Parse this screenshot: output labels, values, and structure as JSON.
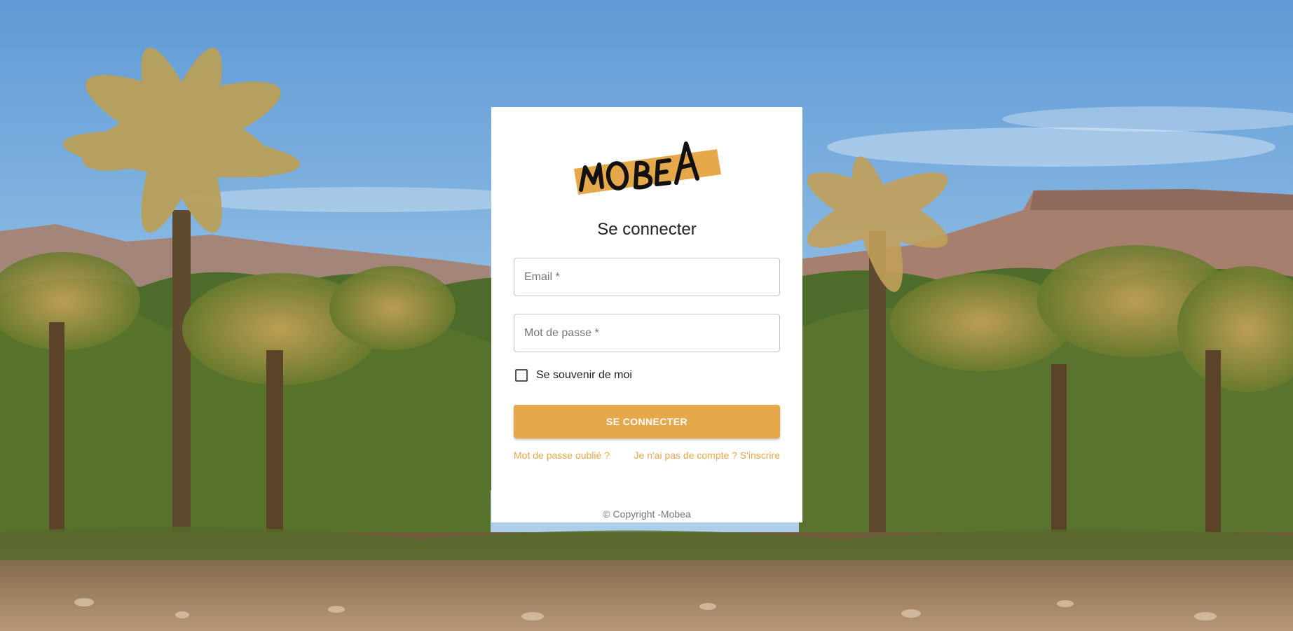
{
  "login": {
    "title": "Se connecter",
    "email_placeholder": "Email *",
    "password_placeholder": "Mot de passe *",
    "remember_label": "Se souvenir de moi",
    "submit_label": "SE CONNECTER",
    "forgot_link": "Mot de passe oublié ?",
    "signup_link": "Je n'ai pas de compte ? S'inscrire",
    "copyright": "© Copyright -Mobea"
  },
  "logo": {
    "text": "MOBEA"
  },
  "colors": {
    "accent": "#e5a84b",
    "card_bg": "#ffffff",
    "sky": "#7fb1dd",
    "mountains": "#a57f72",
    "palms": "#3e5a21",
    "ground": "#a98c6e"
  }
}
